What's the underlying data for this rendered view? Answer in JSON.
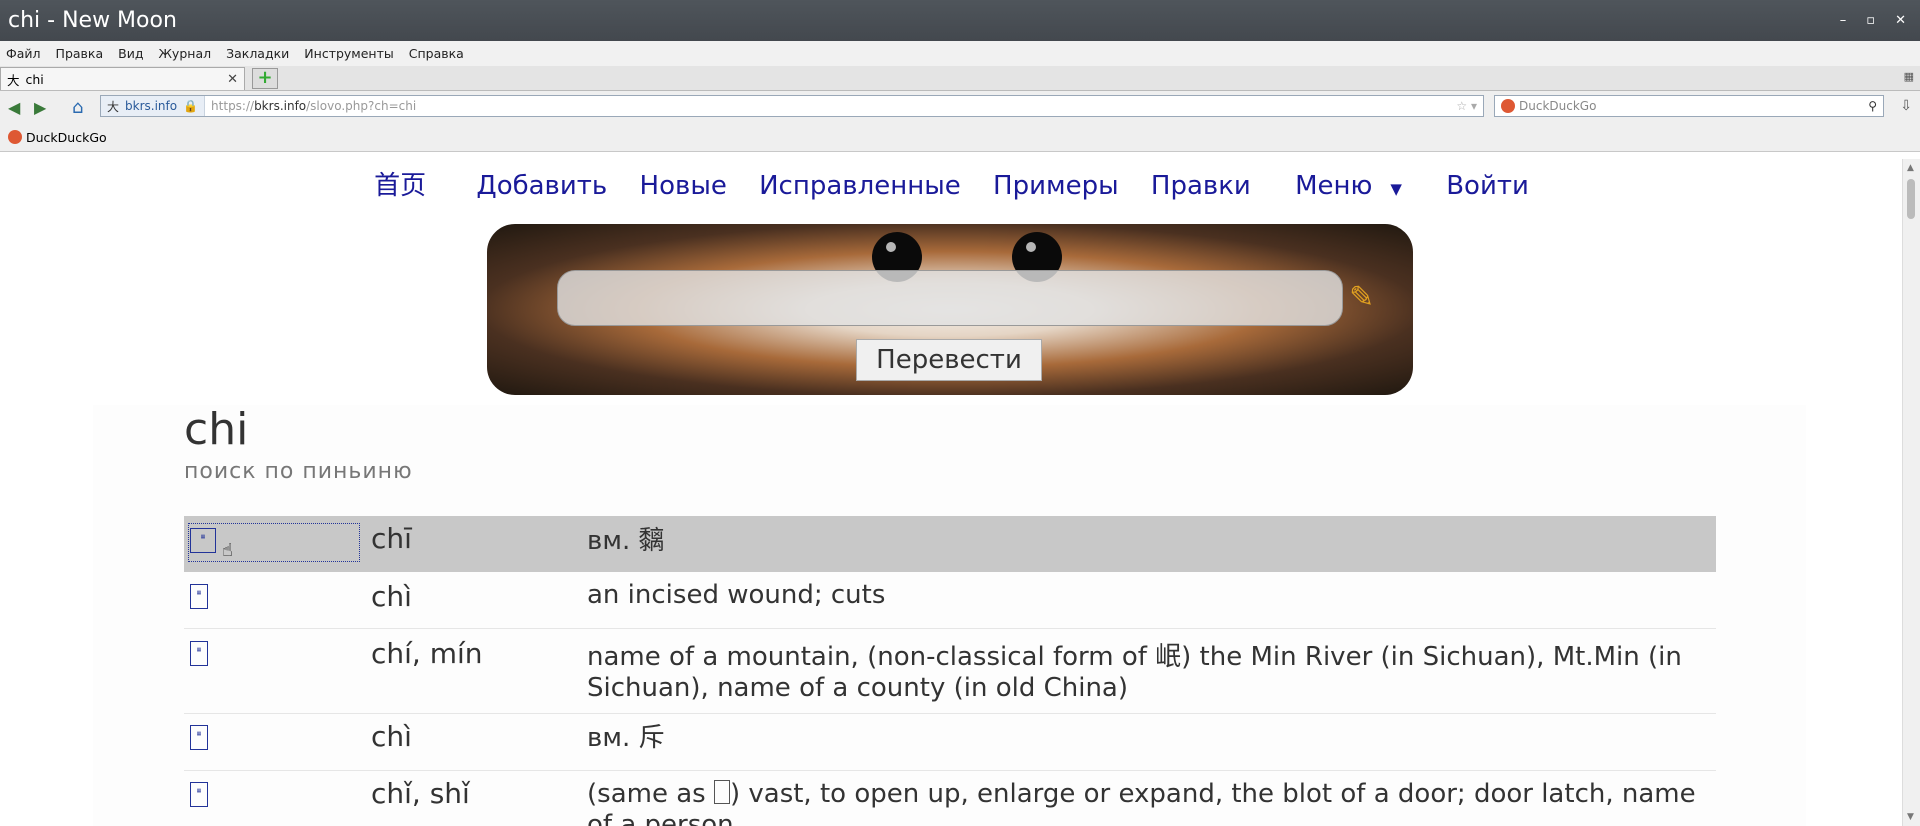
{
  "window": {
    "title": "chi - New Moon",
    "controls": [
      "–",
      "▫",
      "✕"
    ]
  },
  "menubar": [
    "Файл",
    "Правка",
    "Вид",
    "Журнал",
    "Закладки",
    "Инструменты",
    "Справка"
  ],
  "tabs": [
    {
      "label": "chi",
      "icon": "大"
    }
  ],
  "navbar": {
    "identity": "bkrs.info",
    "url_prefix": "https://",
    "url_domain": "bkrs.info",
    "url_path": "/slovo.php?ch=chi",
    "search_placeholder": "DuckDuckGo"
  },
  "bookmarks": [
    {
      "label": "DuckDuckGo"
    }
  ],
  "site_nav": [
    "首页",
    "Добавить",
    "Новые",
    "Исправленные",
    "Примеры",
    "Правки",
    "Меню",
    "Войти"
  ],
  "search_form": {
    "input_value": "",
    "button_label": "Перевести"
  },
  "heading": "chi",
  "subheading": "поиск по пиньиню",
  "results": [
    {
      "pinyin": "chī",
      "definition": "вм. 黐",
      "selected": true
    },
    {
      "pinyin": "chì",
      "definition": "an incised wound; cuts",
      "selected": false
    },
    {
      "pinyin": "chí, mín",
      "definition": "name of a mountain, (non-classical form of 岷) the Min River (in Sichuan), Mt.Min (in Sichuan), name of a county (in old China)",
      "selected": false
    },
    {
      "pinyin": "chì",
      "definition": "вм. 斥",
      "selected": false
    },
    {
      "pinyin": "chǐ, shǐ",
      "definition_before": "(same as",
      "definition_after": ") vast, to open up, enlarge or expand, the blot of a door; door latch, name of a person",
      "selected": false
    }
  ],
  "colors": {
    "site_link": "#1a1a99",
    "selected_row": "#c8c8c8",
    "titlebar": "#4a4f55"
  }
}
